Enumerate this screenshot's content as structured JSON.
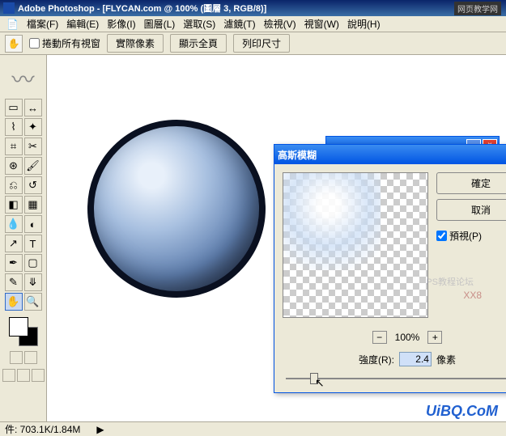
{
  "app": {
    "title": "Adobe Photoshop - [FLYCAN.com @ 100% (圖層 3, RGB/8)]",
    "watermark_top": "网页教学网",
    "watermark_bottom": "UiBQ.CoM",
    "watermark_mid": "XX8",
    "watermark_mid2": "PS教程论坛"
  },
  "menu": {
    "items": [
      "檔案(F)",
      "編輯(E)",
      "影像(I)",
      "圖層(L)",
      "選取(S)",
      "濾鏡(T)",
      "檢視(V)",
      "視窗(W)",
      "說明(H)"
    ]
  },
  "options": {
    "scroll_all": "捲動所有視窗",
    "btn1": "實際像素",
    "btn2": "顯示全頁",
    "btn3": "列印尺寸"
  },
  "dialog": {
    "title": "高斯模糊",
    "ok": "確定",
    "cancel": "取消",
    "preview": "預視(P)",
    "zoom": "100%",
    "radius_label": "強度(R):",
    "radius_value": "2.4",
    "radius_unit": "像素"
  },
  "status": {
    "docsize": "件: 703.1K/1.84M"
  },
  "tools": {
    "names": [
      "move",
      "marquee",
      "lasso",
      "wand",
      "crop",
      "slice",
      "heal",
      "brush",
      "stamp",
      "history",
      "eraser",
      "gradient",
      "blur",
      "dodge",
      "path",
      "type",
      "pen",
      "shape",
      "notes",
      "eyedrop",
      "hand",
      "zoom"
    ]
  }
}
